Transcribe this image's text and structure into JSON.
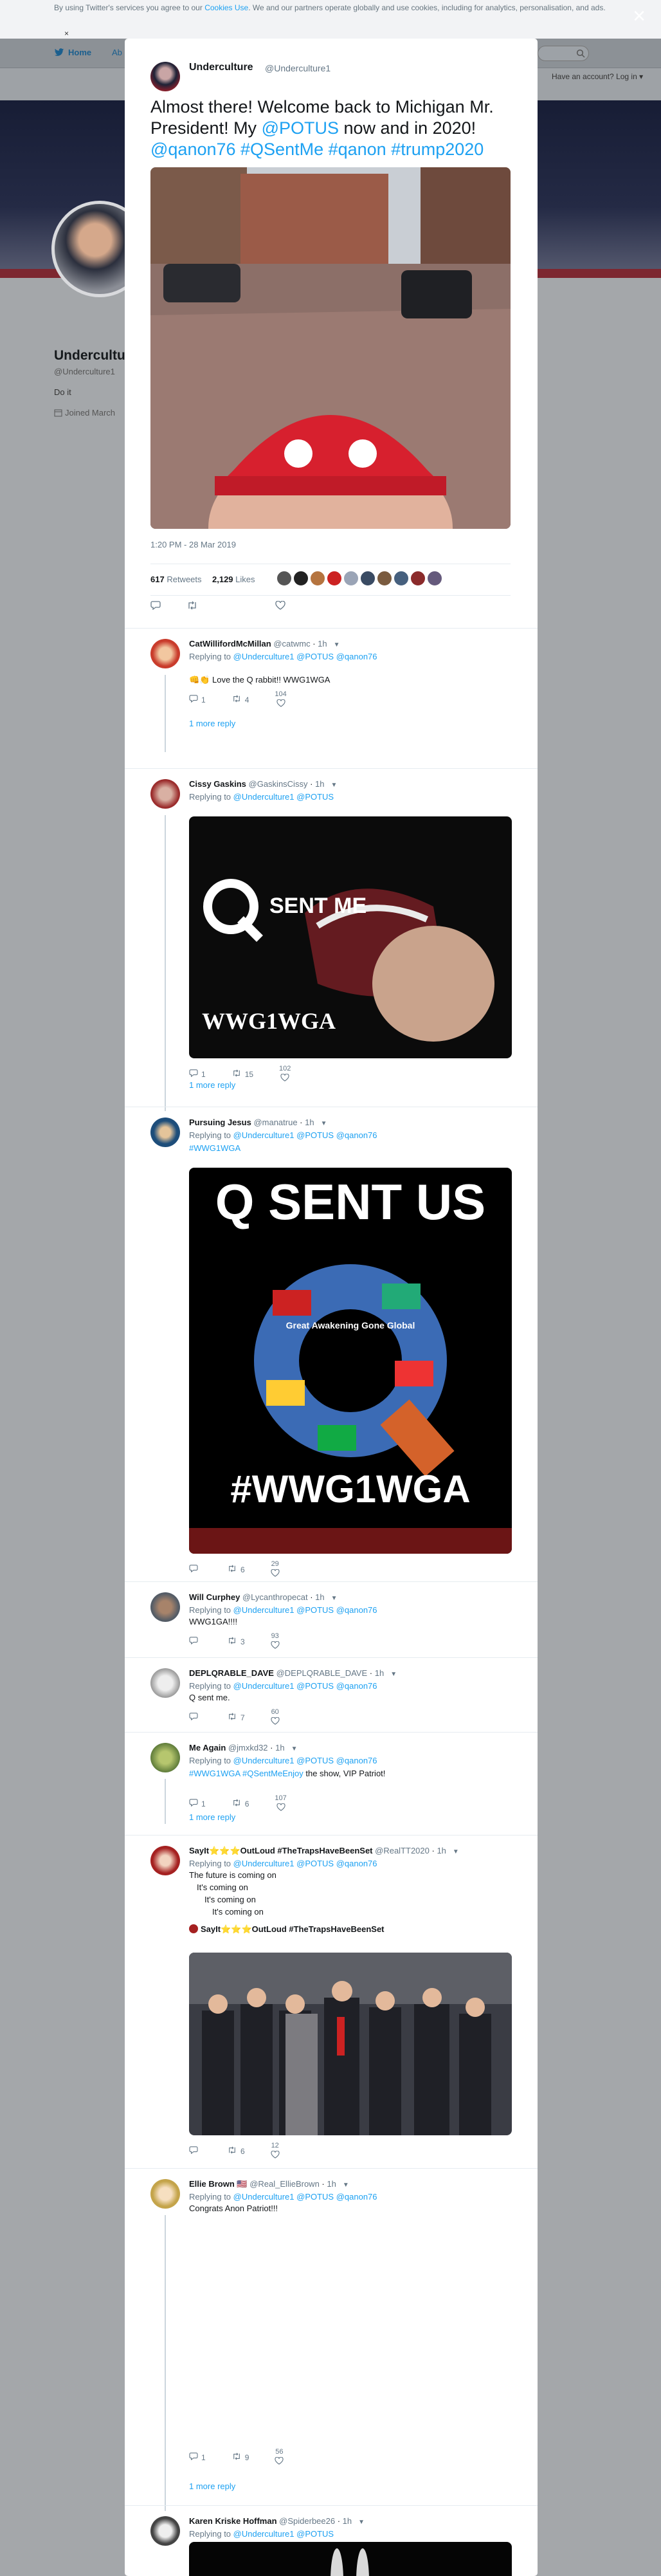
{
  "cookie": {
    "text1": "By using Twitter's services you agree to our ",
    "link": "Cookies Use",
    "text2": ". We and our partners operate globally and use cookies, including for analytics, personalisation, and ads.",
    "dismiss": "×"
  },
  "overlay_close": "×",
  "nav": {
    "home": "Home",
    "about": "Ab",
    "join": "Have an account? Log in ▾"
  },
  "profile": {
    "name": "Underculture",
    "handle": "@Underculture1",
    "bio": "Do it",
    "joined": "Joined March"
  },
  "tweet": {
    "name": "Underculture",
    "handle": "@Underculture1",
    "text_a": "Almost there! Welcome back to Michigan Mr. President! My ",
    "mention": "@POTUS",
    "text_b": " now and in 2020! ",
    "tags": "@qanon76 #QSentMe #qanon #trump2020",
    "time": "1:20 PM - 28 Mar 2019",
    "retweets": "617",
    "retweets_label": "Retweets",
    "likes": "2,129",
    "likes_label": "Likes"
  },
  "replies": [
    {
      "name": "CatWillifordMcMillan",
      "handle": "@catwmc",
      "time": "1h",
      "replying": "Replying to ",
      "to": "@Underculture1 @POTUS @qanon76",
      "text": "👊👏 Love the Q rabbit!! WWG1WGA",
      "c_reply": "1",
      "c_rt": "4",
      "c_like": "104",
      "more": "1 more reply"
    },
    {
      "name": "Cissy Gaskins",
      "handle": "@GaskinsCissy",
      "time": "1h",
      "replying": "Replying to ",
      "to": "@Underculture1 @POTUS",
      "img_text1": "SENT ME",
      "img_text2": "WWG1WGA",
      "c_reply": "1",
      "c_rt": "15",
      "c_like": "102",
      "more": "1 more reply"
    },
    {
      "name": "Pursuing Jesus",
      "handle": "@manatrue",
      "time": "1h",
      "replying": "Replying to ",
      "to": "@Underculture1 @POTUS @qanon76",
      "tags": "#WWG1WGA",
      "img_title": "Q SENT US",
      "img_sub": "Great Awakening Gone Global",
      "img_tag": "#WWG1WGA",
      "c_reply": "",
      "c_rt": "6",
      "c_like": "29"
    },
    {
      "name": "Will Curphey",
      "handle": "@Lycanthropecat",
      "time": "1h",
      "replying": "Replying to ",
      "to": "@Underculture1 @POTUS @qanon76",
      "text": "WWG1GA!!!!",
      "c_reply": "",
      "c_rt": "3",
      "c_like": "93"
    },
    {
      "name": "DEPLQRABLE_DAVE",
      "handle": "@DEPLQRABLE_DAVE",
      "time": "1h",
      "replying": "Replying to ",
      "to": "@Underculture1 @POTUS @qanon76",
      "text": "Q sent me.",
      "c_reply": "",
      "c_rt": "7",
      "c_like": "60"
    },
    {
      "name": "Me Again",
      "handle": "@jmxkd32",
      "time": "1h",
      "replying": "Replying to ",
      "to": "@Underculture1 @POTUS @qanon76",
      "tags": "#WWG1WGA #QSentMeEnjoy",
      "text": " the show, VIP Patriot!",
      "c_reply": "1",
      "c_rt": "6",
      "c_like": "107",
      "more": "1 more reply"
    },
    {
      "name": "SayIt⭐⭐⭐OutLoud #TheTrapsHaveBeenSet",
      "handle": "@RealTT2020",
      "time": "1h",
      "replying": "Replying to ",
      "to": "@Underculture1 @POTUS @qanon76",
      "lines": [
        "The future is coming on",
        "It's coming on",
        "It's coming on",
        "It's coming on"
      ],
      "quote_name": "SayIt⭐⭐⭐OutLoud #TheTrapsHaveBeenSet",
      "c_reply": "",
      "c_rt": "6",
      "c_like": "12"
    },
    {
      "name": "Ellie Brown 🇺🇸",
      "handle": "@Real_EllieBrown",
      "time": "1h",
      "replying": "Replying to ",
      "to": "@Underculture1 @POTUS @qanon76",
      "text": "Congrats Anon Patriot!!!",
      "c_reply": "1",
      "c_rt": "9",
      "c_like": "56",
      "more": "1 more reply"
    },
    {
      "name": "Karen Kriske Hoffman",
      "handle": "@Spiderbee26",
      "time": "1h",
      "replying": "Replying to ",
      "to": "@Underculture1 @POTUS"
    }
  ],
  "colors": {
    "accent": "#1da1f2",
    "thread": "#ccd6dd",
    "like": "#e0245e"
  }
}
